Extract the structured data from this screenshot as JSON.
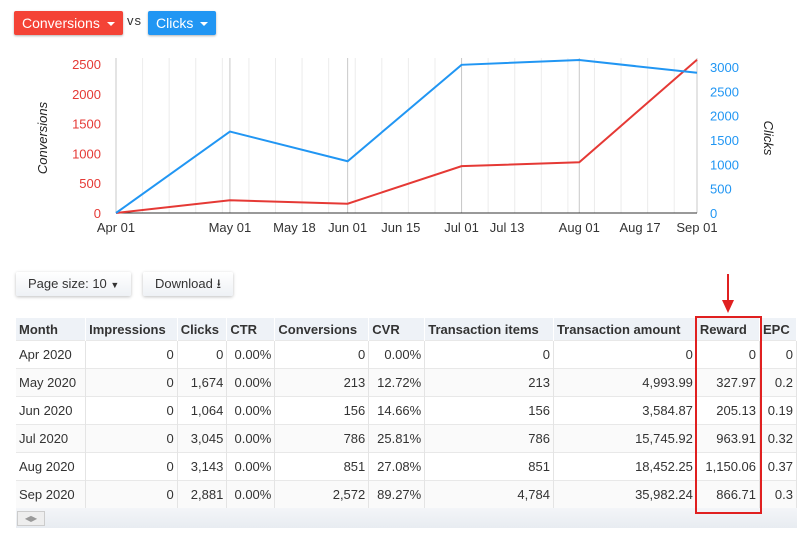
{
  "controls": {
    "metric_left": "Conversions",
    "vs": "vs",
    "metric_right": "Clicks",
    "left_color": "#f44336",
    "right_color": "#2196f3"
  },
  "chart_data": {
    "type": "line",
    "x": [
      "2020-04-01",
      "2020-05-01",
      "2020-06-01",
      "2020-07-01",
      "2020-08-01",
      "2020-09-01"
    ],
    "x_ticks": [
      "Apr 01",
      "May 01",
      "May 18",
      "Jun 01",
      "Jun 15",
      "Jul 01",
      "Jul 13",
      "Aug 01",
      "Aug 17",
      "Sep 01"
    ],
    "y_left": {
      "label": "Conversions",
      "ticks": [
        "0",
        "500",
        "1000",
        "1500",
        "2000",
        "2500"
      ]
    },
    "y_right": {
      "label": "Clicks",
      "ticks": [
        "0",
        "500",
        "1000",
        "1500",
        "2000",
        "2500",
        "3000"
      ]
    },
    "series": [
      {
        "name": "Conversions",
        "axis": "left",
        "color": "#e53935",
        "values": [
          0,
          213,
          156,
          786,
          851,
          2572
        ]
      },
      {
        "name": "Clicks",
        "axis": "right",
        "color": "#2196f3",
        "values": [
          0,
          1674,
          1064,
          3045,
          3143,
          2881
        ]
      }
    ],
    "grid": true
  },
  "toolbar": {
    "page_size": "Page size: 10",
    "download": "Download"
  },
  "table": {
    "headers": [
      "Month",
      "Impressions",
      "Clicks",
      "CTR",
      "Conversions",
      "CVR",
      "Transaction items",
      "Transaction amount",
      "Reward",
      "EPC"
    ],
    "rows": [
      [
        "Apr 2020",
        "0",
        "0",
        "0.00%",
        "0",
        "0.00%",
        "0",
        "0",
        "0",
        "0"
      ],
      [
        "May 2020",
        "0",
        "1,674",
        "0.00%",
        "213",
        "12.72%",
        "213",
        "4,993.99",
        "327.97",
        "0.2"
      ],
      [
        "Jun 2020",
        "0",
        "1,064",
        "0.00%",
        "156",
        "14.66%",
        "156",
        "3,584.87",
        "205.13",
        "0.19"
      ],
      [
        "Jul 2020",
        "0",
        "3,045",
        "0.00%",
        "786",
        "25.81%",
        "786",
        "15,745.92",
        "963.91",
        "0.32"
      ],
      [
        "Aug 2020",
        "0",
        "3,143",
        "0.00%",
        "851",
        "27.08%",
        "851",
        "18,452.25",
        "1,150.06",
        "0.37"
      ],
      [
        "Sep 2020",
        "0",
        "2,881",
        "0.00%",
        "2,572",
        "89.27%",
        "4,784",
        "35,982.24",
        "866.71",
        "0.3"
      ]
    ]
  },
  "annotation": {
    "color": "#e02020",
    "highlighted_column": "Reward"
  }
}
